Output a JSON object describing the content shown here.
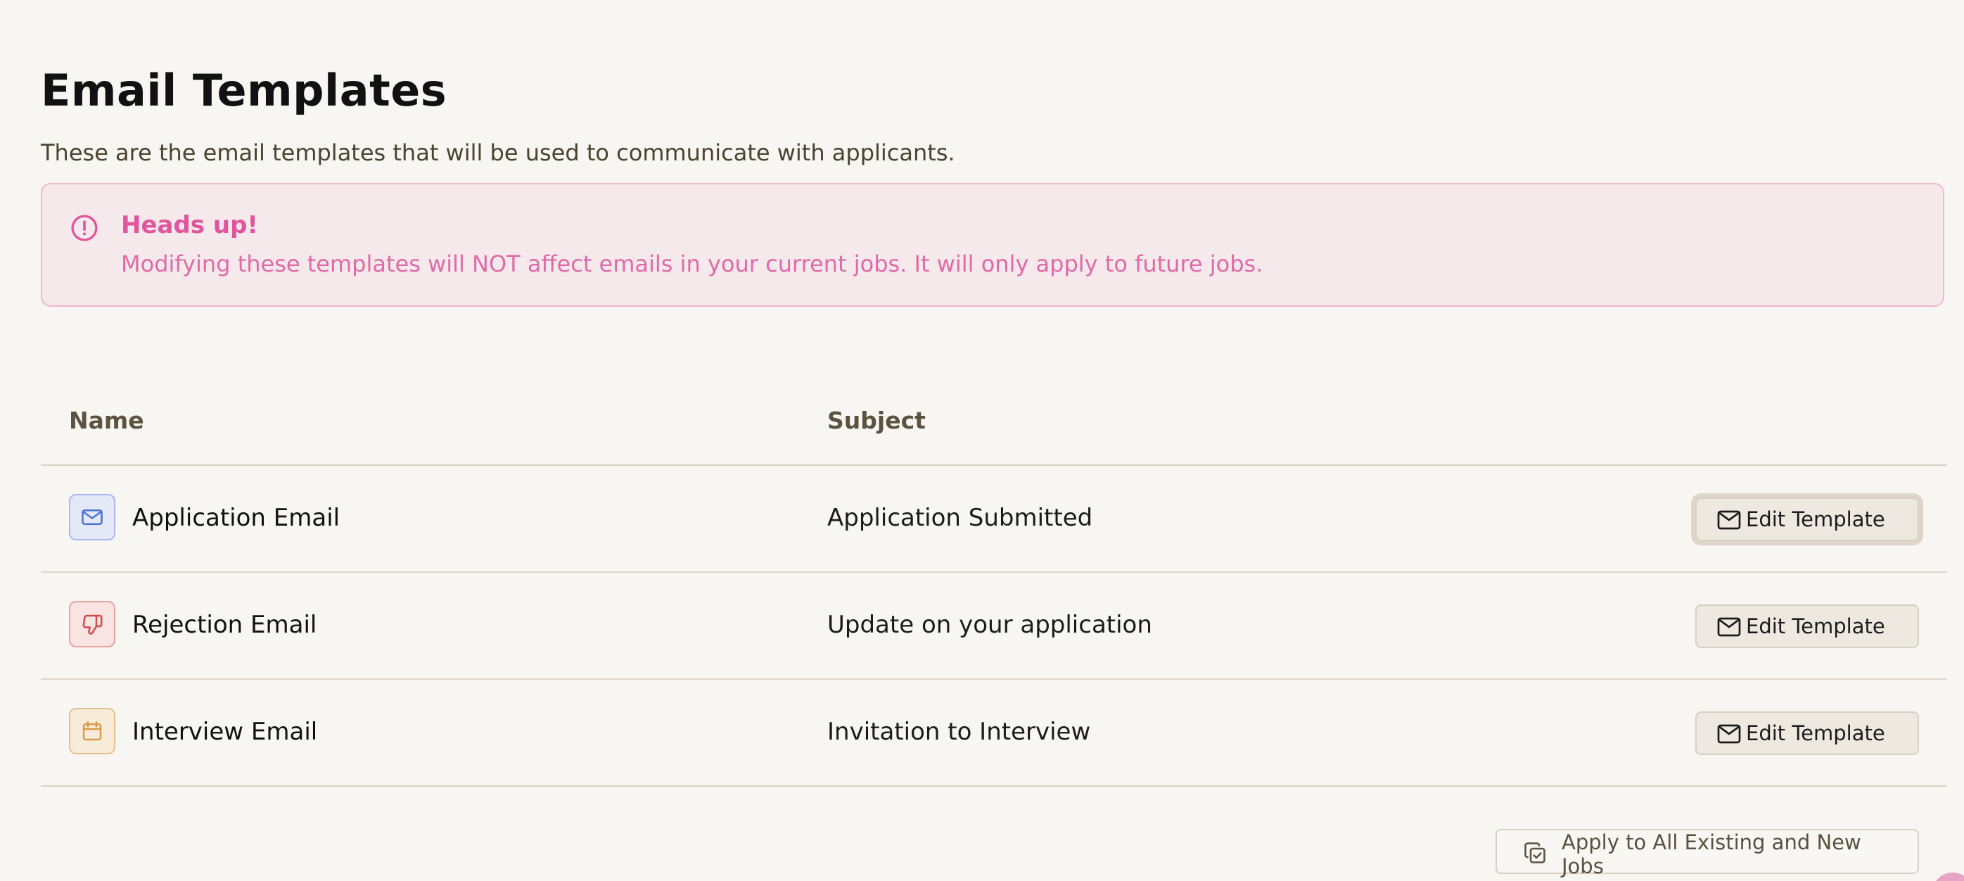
{
  "page": {
    "title": "Email Templates",
    "subtitle": "These are the email templates that will be used to communicate with applicants."
  },
  "alert": {
    "title": "Heads up!",
    "message": "Modifying these templates will NOT affect emails in your current jobs. It will only apply to future jobs.",
    "icon": "alert-circle-icon",
    "color": "#e0559b"
  },
  "table": {
    "headers": {
      "name": "Name",
      "subject": "Subject"
    },
    "rows": [
      {
        "name": "Application Email",
        "subject": "Application Submitted",
        "icon": "mail-icon",
        "icon_color": "#4a73d8",
        "button_label": "Edit Template"
      },
      {
        "name": "Rejection Email",
        "subject": "Update on your application",
        "icon": "thumbs-down-icon",
        "icon_color": "#d24b47",
        "button_label": "Edit Template"
      },
      {
        "name": "Interview Email",
        "subject": "Invitation to Interview",
        "icon": "calendar-icon",
        "icon_color": "#d99b47",
        "button_label": "Edit Template"
      }
    ]
  },
  "actions": {
    "apply_label": "Apply to All Existing and New Jobs",
    "apply_icon": "copy-check-icon"
  }
}
